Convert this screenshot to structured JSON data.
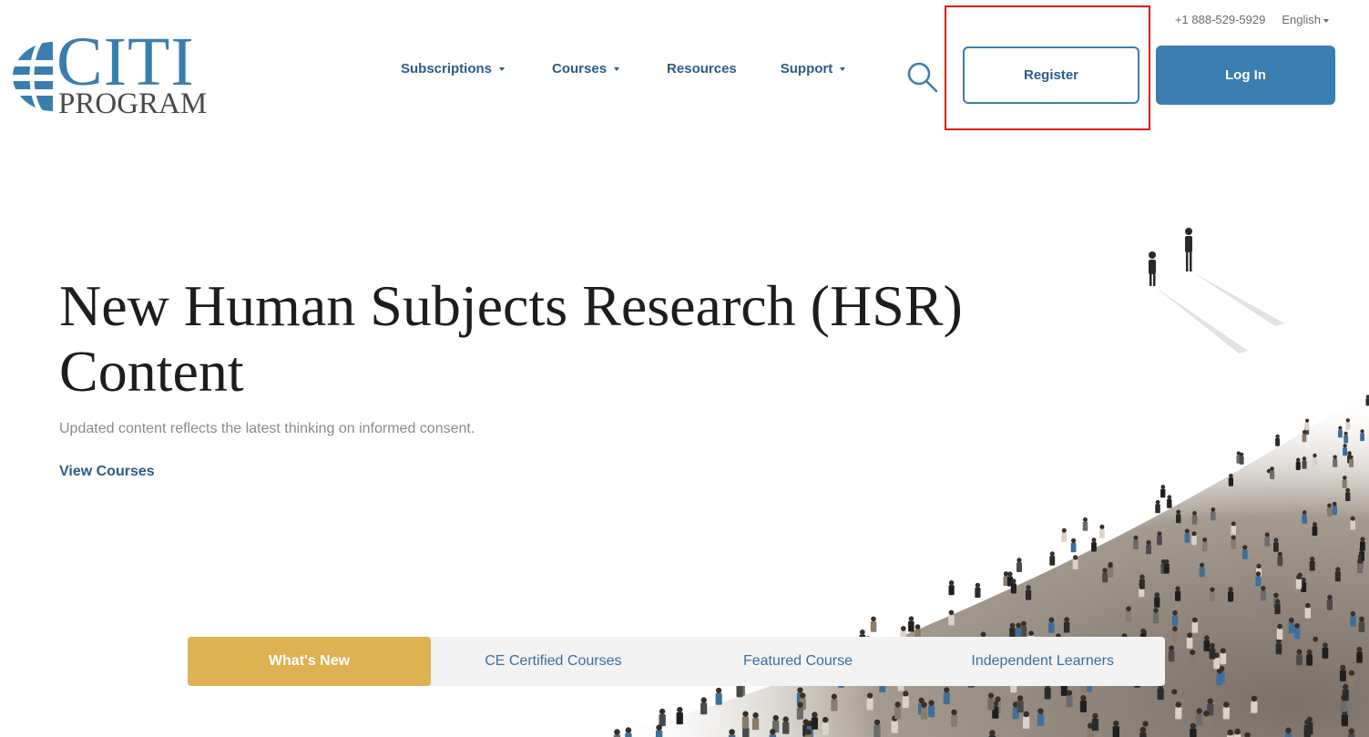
{
  "logo": {
    "main_text": "CITI",
    "sub_text": "PROGRAM",
    "icon": "globe-logo-icon"
  },
  "utility": {
    "phone": "+1 888-529-5929",
    "language": "English"
  },
  "nav": {
    "items": [
      {
        "label": "Subscriptions",
        "has_dropdown": true
      },
      {
        "label": "Courses",
        "has_dropdown": true
      },
      {
        "label": "Resources",
        "has_dropdown": false
      },
      {
        "label": "Support",
        "has_dropdown": true
      }
    ],
    "search_icon": "search-icon"
  },
  "actions": {
    "register_label": "Register",
    "login_label": "Log In"
  },
  "hero": {
    "title": "New Human Subjects Research (HSR) Content",
    "subtitle": "Updated content reflects the latest thinking on informed consent.",
    "link_label": "View Courses"
  },
  "tabs": [
    {
      "label": "What's New",
      "active": true
    },
    {
      "label": "CE Certified Courses",
      "active": false
    },
    {
      "label": "Featured Course",
      "active": false
    },
    {
      "label": "Independent Learners",
      "active": false
    }
  ],
  "colors": {
    "brand_blue": "#3a7db0",
    "nav_blue": "#2b5c88",
    "tab_active": "#deb152",
    "highlight_red": "#e01818"
  }
}
